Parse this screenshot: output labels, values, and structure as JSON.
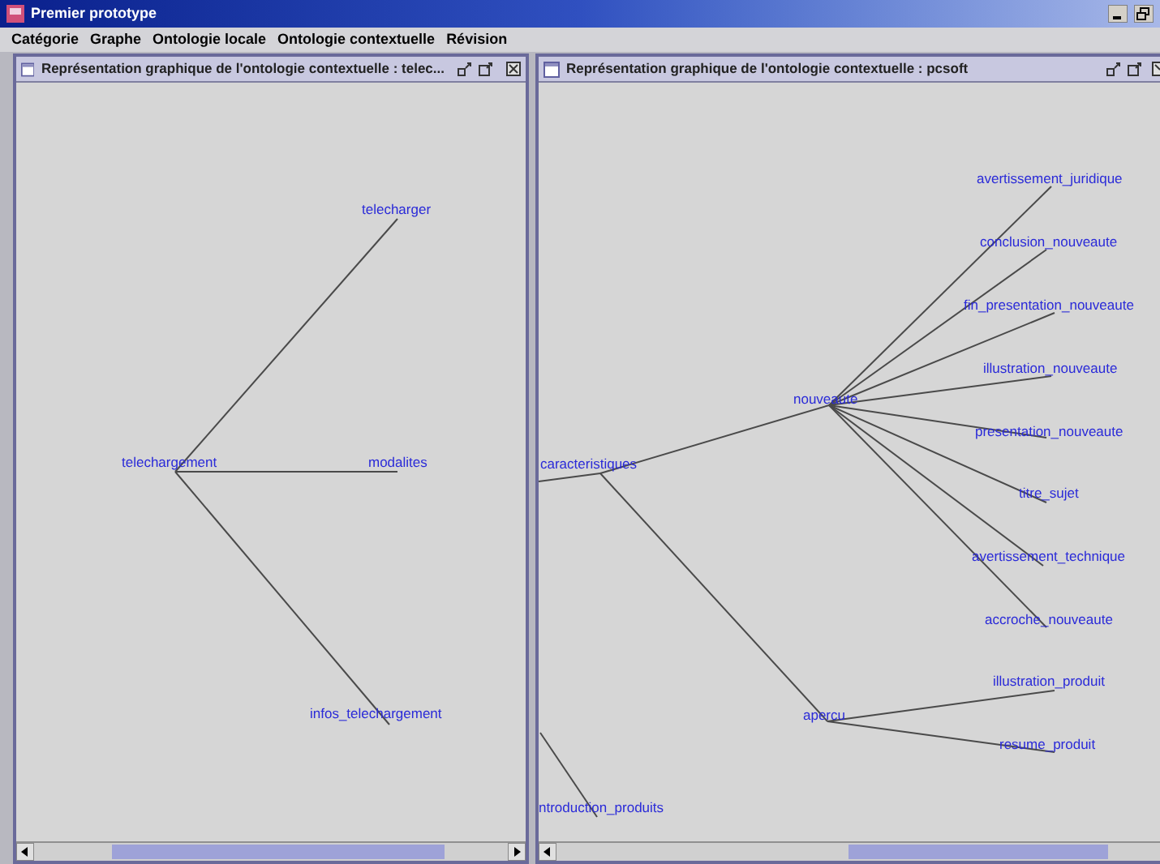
{
  "window": {
    "title": "Premier prototype"
  },
  "menu": [
    "Catégorie",
    "Graphe",
    "Ontologie locale",
    "Ontologie contextuelle",
    "Révision"
  ],
  "frames": [
    {
      "title": "Représentation graphique de l'ontologie contextuelle : telec...",
      "graph": [
        {
          "label": "telechargement",
          "children": [
            {
              "label": "telecharger"
            },
            {
              "label": "modalites"
            },
            {
              "label": "infos_telechargement"
            }
          ]
        }
      ]
    },
    {
      "title": "Représentation graphique de l'ontologie contextuelle : pcsoft",
      "graph": [
        {
          "label": "caracteristiques",
          "children": [
            {
              "label": "nouveaute",
              "children": [
                {
                  "label": "avertissement_juridique"
                },
                {
                  "label": "conclusion_nouveaute"
                },
                {
                  "label": "fin_presentation_nouveaute"
                },
                {
                  "label": "illustration_nouveaute"
                },
                {
                  "label": "presentation_nouveaute"
                },
                {
                  "label": "titre_sujet"
                },
                {
                  "label": "avertissement_technique"
                },
                {
                  "label": "accroche_nouveaute"
                }
              ]
            },
            {
              "label": "apercu",
              "children": [
                {
                  "label": "illustration_produit"
                },
                {
                  "label": "resume_produit"
                }
              ]
            }
          ]
        },
        {
          "label": "ntroduction_produits"
        }
      ]
    }
  ]
}
